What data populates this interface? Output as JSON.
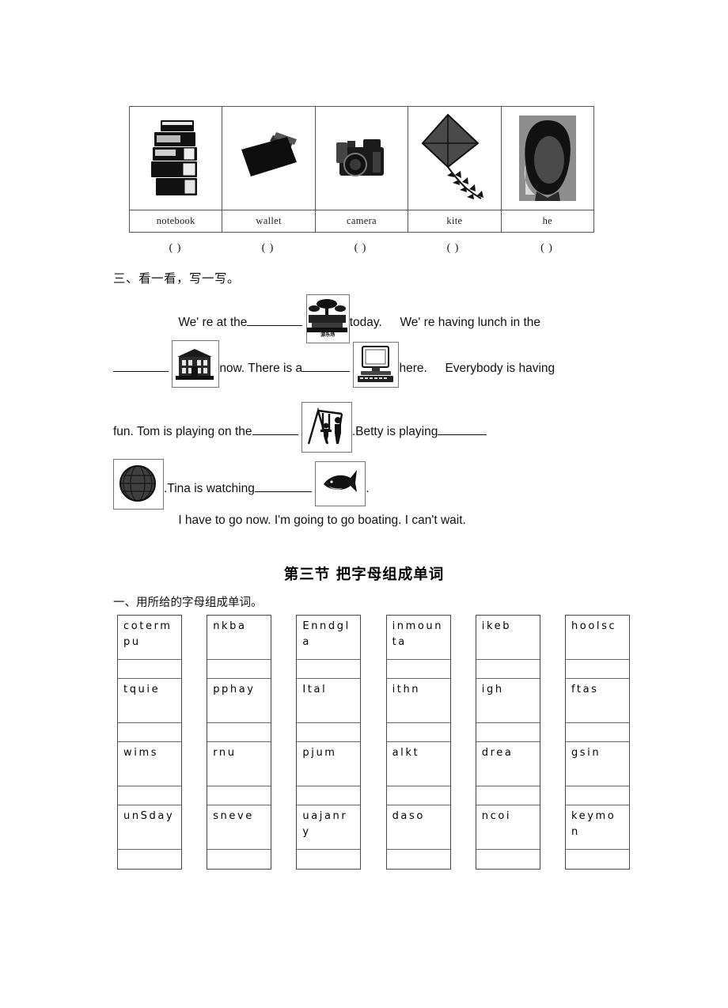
{
  "picture_table": {
    "columns": [
      {
        "image": "stack-of-books-image",
        "word": "notebook",
        "answer": "(    )"
      },
      {
        "image": "wallet-image",
        "word": "wallet",
        "answer": "(    )"
      },
      {
        "image": "camera-image",
        "word": "camera",
        "answer": "(    )"
      },
      {
        "image": "kite-image",
        "word": "kite",
        "answer": "(    )"
      },
      {
        "image": "girl-head-image",
        "word": "he",
        "answer": "(    )"
      }
    ]
  },
  "exercise_three": {
    "heading": "三、看一看，写一写。",
    "line1": {
      "text_a": "We' re at the",
      "picture": "amusement-park-image",
      "picture_caption": "游乐场",
      "text_b": "today.",
      "text_c": "We' re having lunch in the"
    },
    "line2": {
      "picture_a": "school-building-image",
      "text_a": "now. There is a",
      "picture_b": "computer-image",
      "text_b": "here.",
      "text_c": "Everybody is having"
    },
    "line3": {
      "text_a": "fun.   Tom   is   playing   on   the",
      "picture": "swing-set-image",
      "text_b": ".Betty   is   playing"
    },
    "line4": {
      "picture_a": "ball-image",
      "text_a": ".Tina is watching",
      "picture_b": "fish-image",
      "text_b": "."
    },
    "line5": "I have to go now. I'm going to go boating. I can't wait."
  },
  "section_three": {
    "title": "第三节 把字母组成单词",
    "instruction": "一、用所给的字母组成单词。",
    "columns": [
      {
        "letters": [
          "cotermpu",
          "tquie",
          "wims",
          "unSday"
        ]
      },
      {
        "letters": [
          "nkba",
          "pphay",
          "rnu",
          "sneve"
        ]
      },
      {
        "letters": [
          "Enndgla",
          "Ital",
          "pjum",
          "uajanry"
        ]
      },
      {
        "letters": [
          "inmounta",
          "ithn",
          "alkt",
          "daso"
        ]
      },
      {
        "letters": [
          "ikeb",
          "igh",
          "drea",
          "ncoi"
        ]
      },
      {
        "letters": [
          "hoolsc",
          "ftas",
          "gsin",
          "keymon"
        ]
      }
    ],
    "answer_placeholder": ""
  },
  "colors": {
    "ink": "#111111",
    "rule": "#555555",
    "page": "#ffffff"
  }
}
